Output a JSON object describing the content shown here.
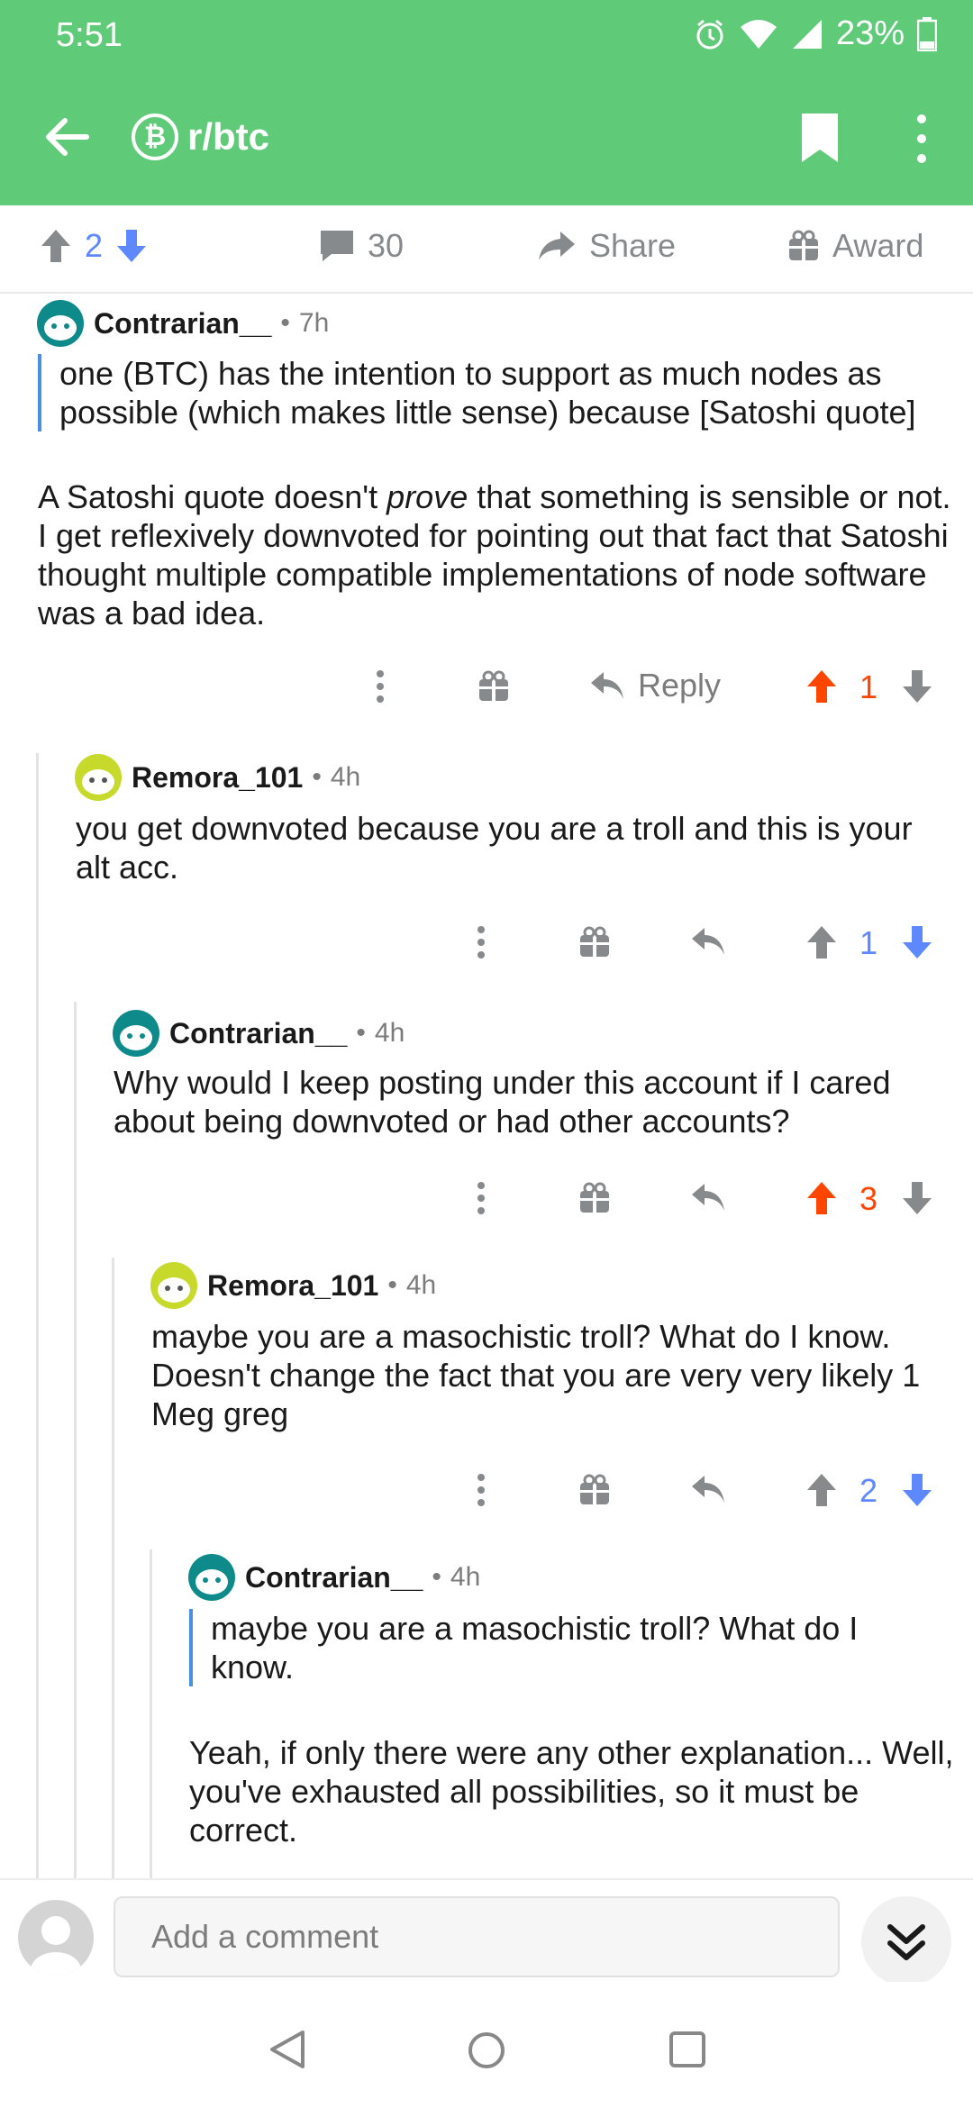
{
  "status_bar": {
    "time": "5:51",
    "battery": "23%"
  },
  "app_bar": {
    "subreddit": "r/btc"
  },
  "post_actions": {
    "score": "2",
    "comments": "30",
    "share": "Share",
    "award": "Award"
  },
  "comments": [
    {
      "user": "Contrarian__",
      "age": "7h",
      "quote": "one (BTC) has the intention to support as much nodes as possible (which makes little sense) because [Satoshi quote]",
      "body_pre": "A Satoshi quote doesn't ",
      "body_em": "prove",
      "body_post": " that something is sensible or not. I get reflexively downvoted for pointing out that fact that Satoshi thought multiple compatible implementations of node software was a bad idea.",
      "reply": "Reply",
      "score": "1"
    },
    {
      "user": "Remora_101",
      "age": "4h",
      "body": "you get downvoted because you are a troll and this is your alt acc.",
      "score": "1"
    },
    {
      "user": "Contrarian__",
      "age": "4h",
      "body": "Why would I keep posting under this account if I cared about being downvoted or had other accounts?",
      "score": "3"
    },
    {
      "user": "Remora_101",
      "age": "4h",
      "body": "maybe you are a masochistic troll? What do I know. Doesn't change the fact that you are very very likely 1 Meg greg",
      "score": "2"
    },
    {
      "user": "Contrarian__",
      "age": "4h",
      "quote": "maybe you are a masochistic troll? What do I know.",
      "body": "Yeah, if only there were any other explanation... Well, you've exhausted all possibilities, so it must be correct."
    }
  ],
  "composer": {
    "placeholder": "Add a comment"
  },
  "colors": {
    "header": "#5fcb78",
    "upvote": "#ff4500",
    "downvote": "#7193ff",
    "quote_bar": "#4a90e2"
  },
  "icons": [
    "back-arrow-icon",
    "bitcoin-icon",
    "bookmark-icon",
    "more-vert-icon",
    "upvote-icon",
    "downvote-icon",
    "comment-icon",
    "share-icon",
    "gift-icon",
    "reply-icon",
    "chevron-double-down-icon",
    "nav-back-icon",
    "nav-home-icon",
    "nav-recents-icon"
  ],
  "separator": "•"
}
